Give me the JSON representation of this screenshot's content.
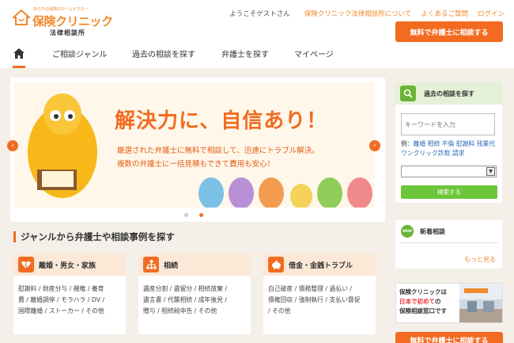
{
  "brand": {
    "tagline": "あなたの保険のホームドクター",
    "name": "保険クリニック",
    "sub": "法律相談所",
    "accent": "#f26b21",
    "green": "#6ab437"
  },
  "header": {
    "welcome": "ようこそゲストさん",
    "links": [
      "保険クリニック法律相談所について",
      "よくあるご質問",
      "ログイン"
    ],
    "cta": "無料で弁護士に相談する"
  },
  "nav": {
    "home_icon": "home-icon",
    "items": [
      "ご相談ジャンル",
      "過去の相談を探す",
      "弁護士を探す",
      "マイページ"
    ]
  },
  "hero": {
    "title": "解決力に、自信あり！",
    "line1": "厳選された弁護士に無料で相談して、迅速にトラブル解決。",
    "line2": "複数の弁護士に一括見積もできて費用も安心！",
    "prev_icon": "chevron-left-icon",
    "next_icon": "chevron-right-icon",
    "slide_count": 2,
    "active_slide": 2
  },
  "genre": {
    "title": "ジャンルから弁護士や相談事例を探す",
    "cards": [
      {
        "icon": "broken-heart-icon",
        "title": "離婚・男女・家族",
        "lines": [
          "慰謝料 / 財産分与 / 親権 / 養育",
          "費 / 離婚調停 / モラハラ / DV /",
          "国際離婚 / ストーカー / その他"
        ]
      },
      {
        "icon": "family-tree-icon",
        "title": "相続",
        "lines": [
          "遺産分割 / 遺留分 / 相続放棄 /",
          "遺言書 / 代襲相続 / 成年後見 /",
          "贈与 / 相続税申告 / その他"
        ]
      },
      {
        "icon": "piggy-bank-icon",
        "title": "借金・金銭トラブル",
        "lines": [
          "自己破産 / 債務整理 / 過払い /",
          "債権回収 / 強制執行 / 支払い督促",
          "/ その他"
        ]
      }
    ]
  },
  "sidebar": {
    "search": {
      "icon": "search-icon",
      "title": "過去の相談を探す",
      "placeholder": "キーワードを入力",
      "examples_label": "例：",
      "examples": [
        "離婚",
        "相続",
        "不倫",
        "慰謝料",
        "残業代",
        "ワンクリック詐欺",
        "請求"
      ],
      "select_value": "",
      "button": "検索する"
    },
    "new": {
      "badge": "NEW",
      "title": "新着相談",
      "more": "もっと見る"
    },
    "banner": {
      "line1": "保険クリニックは",
      "line2a": "日本で初めて",
      "line2b": "の",
      "line3": "保険相談窓口です"
    },
    "cta": "無料で弁護士に相談する"
  }
}
